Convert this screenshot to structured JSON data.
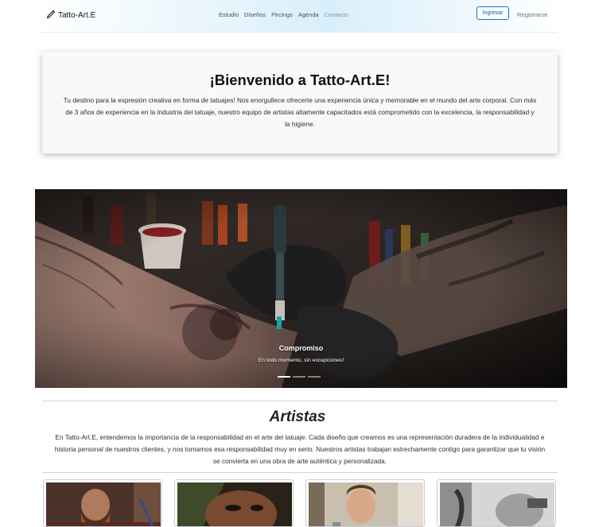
{
  "navbar": {
    "brand": "Tatto-Art.E",
    "links": [
      "Estudio",
      "Diseños",
      "Pircings",
      "Agenda",
      "Contacto"
    ],
    "login_label": "Ingresar",
    "register_label": "Registrarse"
  },
  "welcome": {
    "title": "¡Bienvenido a Tatto-Art.E!",
    "text": "Tu destino para la expresión creativa en forma de tatuajes! Nos enorgullece ofrecerte una experiencia única y memorable en el mundo del arte corporal. Con más de 3 años de experiencia en la industria del tatuaje, nuestro equipo de artistas altamente capacitados está comprometido con la excelencia, la responsabilidad y la higiene."
  },
  "carousel": {
    "caption_title": "Compromiso",
    "caption_text": "En todo momento, sin excepciones!",
    "indicator_count": 3,
    "active_index": 0
  },
  "artists": {
    "title": "Artistas",
    "description": "En Tatto-Art.E, entendemos la importancia de la responsabilidad en el arte del tatuaje. Cada diseño que creamos es una representación duradera de la individualidad e historia personal de nuestros clientes, y nos tomamos esa responsabilidad muy en serio. Nuestros artistas trabajan estrechamente contigo para garantizar que tu visión se convierta en una obra de arte auténtica y personalizada."
  },
  "colors": {
    "accent": "#1a73c9",
    "card_bg": "#f8f9fa",
    "nav_gradient": "#d8f0fb"
  },
  "icons": {
    "brand": "pen-nib-icon"
  }
}
